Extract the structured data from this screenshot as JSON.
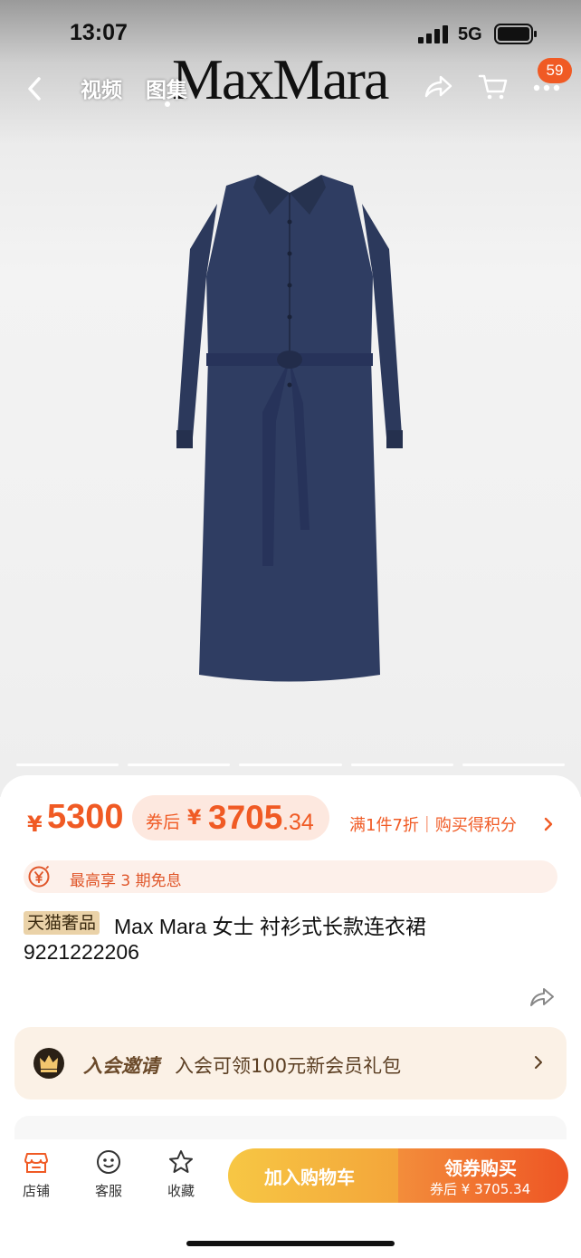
{
  "status_bar": {
    "time": "13:07",
    "network": "5G"
  },
  "nav": {
    "tabs": [
      "视频",
      "图集"
    ],
    "active_tab": "图集",
    "brand_logo": "MaxMara",
    "cart_badge": "59"
  },
  "icons": {
    "back": "chevron-left-icon",
    "share": "share-icon",
    "cart": "cart-icon",
    "more": "more-icon",
    "interest": "yen-circle-icon",
    "crown": "crown-icon",
    "store": "store-icon",
    "service": "chat-face-icon",
    "favorite": "star-icon"
  },
  "gallery": {
    "pages": 5,
    "current": 1
  },
  "price": {
    "currency": "¥",
    "original": "5300",
    "coupon_label": "券后",
    "coupon_currency": "¥",
    "coupon_integer": "3705",
    "coupon_decimal": ".34",
    "promo": "满1件7折｜购买得积分"
  },
  "interest_free": "最高享 3 期免息",
  "product": {
    "tag": "天猫奢品",
    "title_line1": "Max Mara 女士 衬衫式长款连衣裙",
    "title_line2": "9221222206"
  },
  "membership": {
    "title": "入会邀请",
    "description": "入会可领100元新会员礼包"
  },
  "bottom_bar": {
    "store": "店铺",
    "service": "客服",
    "favorite": "收藏",
    "add_to_cart": "加入购物车",
    "buy_now": "领券购买",
    "buy_now_sub": "券后 ¥ 3705.34"
  },
  "colors": {
    "accent": "#f05a24",
    "cart_button": "#f5b53e",
    "buy_button": "#ee5524",
    "dress": "#2e3b5f"
  }
}
